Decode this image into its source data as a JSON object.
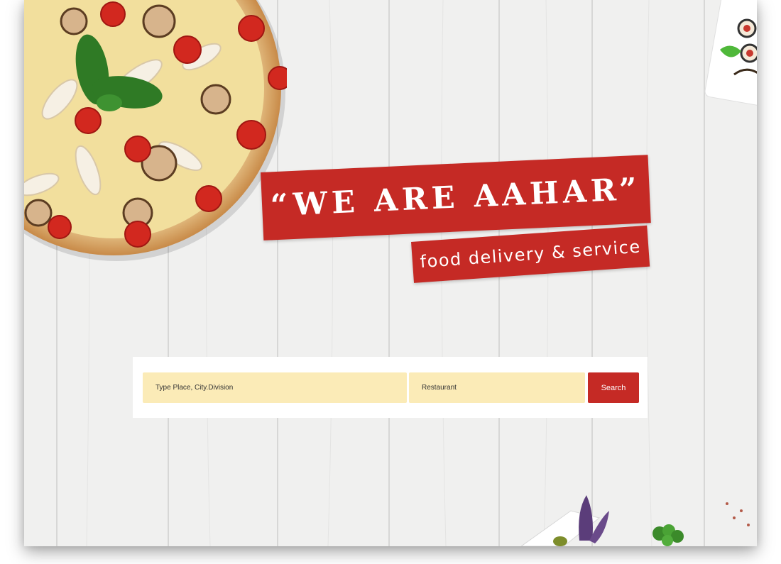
{
  "hero": {
    "headline": "“WE ARE AAHAR”",
    "tagline": "food delivery & service"
  },
  "search": {
    "place_placeholder": "Type Place, City.Division",
    "restaurant_placeholder": "Restaurant",
    "button_label": "Search"
  },
  "colors": {
    "accent": "#c52a25",
    "input_bg": "#fbebb7",
    "wood_bg": "#f1f1f1"
  },
  "decor": {
    "top_left": "pizza-image",
    "top_right": "sushi-plate-image",
    "bottom_right": "herb-garnish-image"
  }
}
